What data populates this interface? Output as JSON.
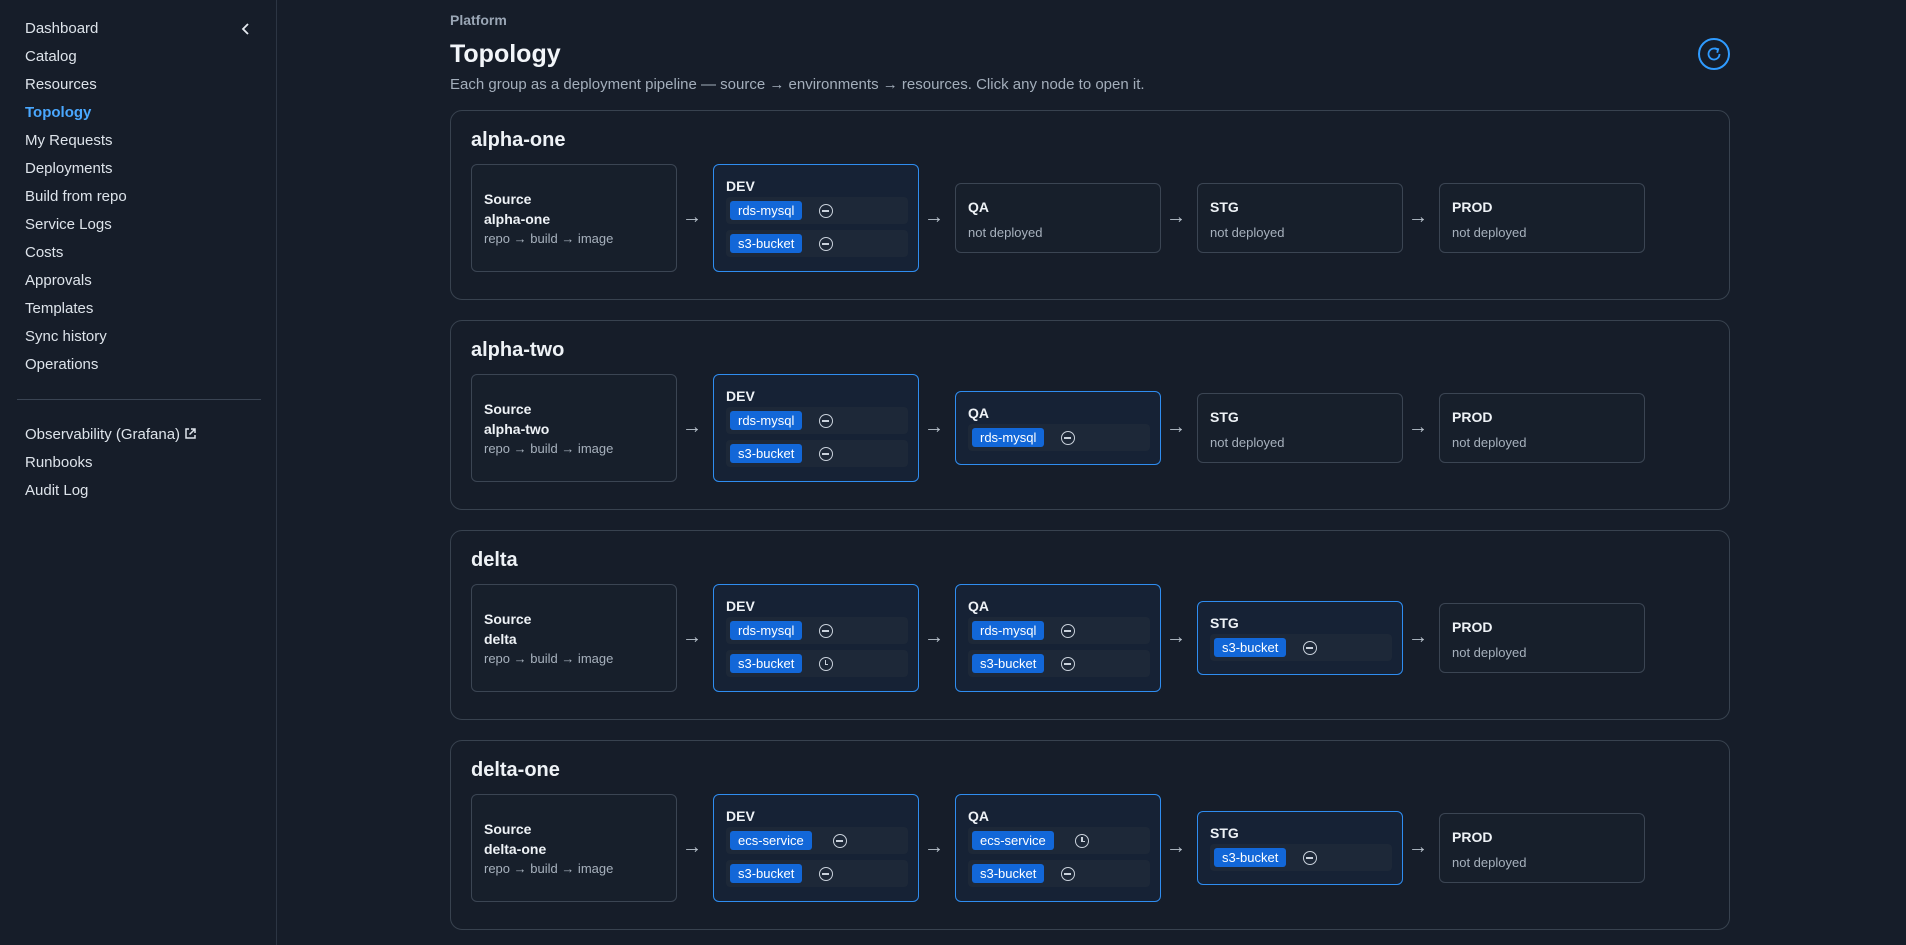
{
  "sidebar": {
    "items": [
      {
        "label": "Dashboard",
        "active": false
      },
      {
        "label": "Catalog",
        "active": false
      },
      {
        "label": "Resources",
        "active": false
      },
      {
        "label": "Topology",
        "active": true
      },
      {
        "label": "My Requests",
        "active": false
      },
      {
        "label": "Deployments",
        "active": false
      },
      {
        "label": "Build from repo",
        "active": false
      },
      {
        "label": "Service Logs",
        "active": false
      },
      {
        "label": "Costs",
        "active": false
      },
      {
        "label": "Approvals",
        "active": false
      },
      {
        "label": "Templates",
        "active": false
      },
      {
        "label": "Sync history",
        "active": false
      },
      {
        "label": "Operations",
        "active": false
      }
    ],
    "secondary": [
      {
        "label": "Observability (Grafana)",
        "external": true
      },
      {
        "label": "Runbooks",
        "external": false
      },
      {
        "label": "Audit Log",
        "external": false
      }
    ],
    "collapse_icon": "chevron-left-icon"
  },
  "header": {
    "breadcrumb": "Platform",
    "title": "Topology",
    "subtitle": "Each group as a deployment pipeline — source → environments → resources. Click any node to open it.",
    "refresh_icon": "refresh-icon"
  },
  "colors": {
    "accent": "#2f9bff",
    "chip": "#1267d8",
    "background": "#161d29"
  },
  "arrow": "→",
  "source_label": "Source",
  "source_pipeline": "repo → build → image",
  "not_deployed": "not deployed",
  "groups": [
    {
      "name": "alpha-one",
      "envs": [
        {
          "name": "DEV",
          "resources": [
            {
              "name": "rds-mysql",
              "status": "minus"
            },
            {
              "name": "s3-bucket",
              "status": "minus"
            }
          ]
        },
        {
          "name": "QA",
          "resources": []
        },
        {
          "name": "STG",
          "resources": []
        },
        {
          "name": "PROD",
          "resources": []
        }
      ]
    },
    {
      "name": "alpha-two",
      "envs": [
        {
          "name": "DEV",
          "resources": [
            {
              "name": "rds-mysql",
              "status": "minus"
            },
            {
              "name": "s3-bucket",
              "status": "minus"
            }
          ]
        },
        {
          "name": "QA",
          "resources": [
            {
              "name": "rds-mysql",
              "status": "minus"
            }
          ]
        },
        {
          "name": "STG",
          "resources": []
        },
        {
          "name": "PROD",
          "resources": []
        }
      ]
    },
    {
      "name": "delta",
      "envs": [
        {
          "name": "DEV",
          "resources": [
            {
              "name": "rds-mysql",
              "status": "minus"
            },
            {
              "name": "s3-bucket",
              "status": "clock"
            }
          ]
        },
        {
          "name": "QA",
          "resources": [
            {
              "name": "rds-mysql",
              "status": "minus"
            },
            {
              "name": "s3-bucket",
              "status": "minus"
            }
          ]
        },
        {
          "name": "STG",
          "resources": [
            {
              "name": "s3-bucket",
              "status": "minus"
            }
          ]
        },
        {
          "name": "PROD",
          "resources": []
        }
      ]
    },
    {
      "name": "delta-one",
      "envs": [
        {
          "name": "DEV",
          "resources": [
            {
              "name": "ecs-service",
              "status": "minus"
            },
            {
              "name": "s3-bucket",
              "status": "minus"
            }
          ]
        },
        {
          "name": "QA",
          "resources": [
            {
              "name": "ecs-service",
              "status": "clock"
            },
            {
              "name": "s3-bucket",
              "status": "minus"
            }
          ]
        },
        {
          "name": "STG",
          "resources": [
            {
              "name": "s3-bucket",
              "status": "minus"
            }
          ]
        },
        {
          "name": "PROD",
          "resources": []
        }
      ]
    }
  ]
}
